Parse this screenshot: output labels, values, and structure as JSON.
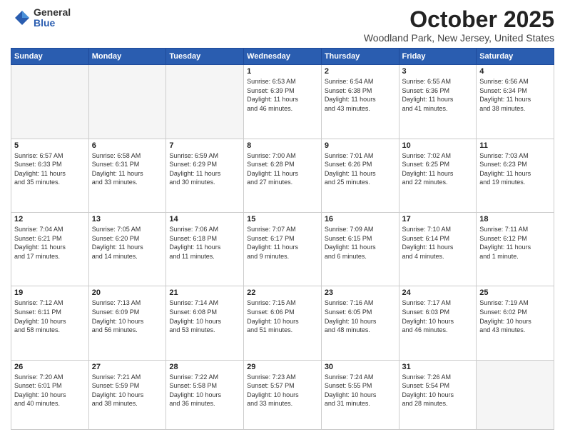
{
  "header": {
    "logo_general": "General",
    "logo_blue": "Blue",
    "month_title": "October 2025",
    "location": "Woodland Park, New Jersey, United States"
  },
  "days_of_week": [
    "Sunday",
    "Monday",
    "Tuesday",
    "Wednesday",
    "Thursday",
    "Friday",
    "Saturday"
  ],
  "weeks": [
    [
      {
        "day": "",
        "info": ""
      },
      {
        "day": "",
        "info": ""
      },
      {
        "day": "",
        "info": ""
      },
      {
        "day": "1",
        "info": "Sunrise: 6:53 AM\nSunset: 6:39 PM\nDaylight: 11 hours\nand 46 minutes."
      },
      {
        "day": "2",
        "info": "Sunrise: 6:54 AM\nSunset: 6:38 PM\nDaylight: 11 hours\nand 43 minutes."
      },
      {
        "day": "3",
        "info": "Sunrise: 6:55 AM\nSunset: 6:36 PM\nDaylight: 11 hours\nand 41 minutes."
      },
      {
        "day": "4",
        "info": "Sunrise: 6:56 AM\nSunset: 6:34 PM\nDaylight: 11 hours\nand 38 minutes."
      }
    ],
    [
      {
        "day": "5",
        "info": "Sunrise: 6:57 AM\nSunset: 6:33 PM\nDaylight: 11 hours\nand 35 minutes."
      },
      {
        "day": "6",
        "info": "Sunrise: 6:58 AM\nSunset: 6:31 PM\nDaylight: 11 hours\nand 33 minutes."
      },
      {
        "day": "7",
        "info": "Sunrise: 6:59 AM\nSunset: 6:29 PM\nDaylight: 11 hours\nand 30 minutes."
      },
      {
        "day": "8",
        "info": "Sunrise: 7:00 AM\nSunset: 6:28 PM\nDaylight: 11 hours\nand 27 minutes."
      },
      {
        "day": "9",
        "info": "Sunrise: 7:01 AM\nSunset: 6:26 PM\nDaylight: 11 hours\nand 25 minutes."
      },
      {
        "day": "10",
        "info": "Sunrise: 7:02 AM\nSunset: 6:25 PM\nDaylight: 11 hours\nand 22 minutes."
      },
      {
        "day": "11",
        "info": "Sunrise: 7:03 AM\nSunset: 6:23 PM\nDaylight: 11 hours\nand 19 minutes."
      }
    ],
    [
      {
        "day": "12",
        "info": "Sunrise: 7:04 AM\nSunset: 6:21 PM\nDaylight: 11 hours\nand 17 minutes."
      },
      {
        "day": "13",
        "info": "Sunrise: 7:05 AM\nSunset: 6:20 PM\nDaylight: 11 hours\nand 14 minutes."
      },
      {
        "day": "14",
        "info": "Sunrise: 7:06 AM\nSunset: 6:18 PM\nDaylight: 11 hours\nand 11 minutes."
      },
      {
        "day": "15",
        "info": "Sunrise: 7:07 AM\nSunset: 6:17 PM\nDaylight: 11 hours\nand 9 minutes."
      },
      {
        "day": "16",
        "info": "Sunrise: 7:09 AM\nSunset: 6:15 PM\nDaylight: 11 hours\nand 6 minutes."
      },
      {
        "day": "17",
        "info": "Sunrise: 7:10 AM\nSunset: 6:14 PM\nDaylight: 11 hours\nand 4 minutes."
      },
      {
        "day": "18",
        "info": "Sunrise: 7:11 AM\nSunset: 6:12 PM\nDaylight: 11 hours\nand 1 minute."
      }
    ],
    [
      {
        "day": "19",
        "info": "Sunrise: 7:12 AM\nSunset: 6:11 PM\nDaylight: 10 hours\nand 58 minutes."
      },
      {
        "day": "20",
        "info": "Sunrise: 7:13 AM\nSunset: 6:09 PM\nDaylight: 10 hours\nand 56 minutes."
      },
      {
        "day": "21",
        "info": "Sunrise: 7:14 AM\nSunset: 6:08 PM\nDaylight: 10 hours\nand 53 minutes."
      },
      {
        "day": "22",
        "info": "Sunrise: 7:15 AM\nSunset: 6:06 PM\nDaylight: 10 hours\nand 51 minutes."
      },
      {
        "day": "23",
        "info": "Sunrise: 7:16 AM\nSunset: 6:05 PM\nDaylight: 10 hours\nand 48 minutes."
      },
      {
        "day": "24",
        "info": "Sunrise: 7:17 AM\nSunset: 6:03 PM\nDaylight: 10 hours\nand 46 minutes."
      },
      {
        "day": "25",
        "info": "Sunrise: 7:19 AM\nSunset: 6:02 PM\nDaylight: 10 hours\nand 43 minutes."
      }
    ],
    [
      {
        "day": "26",
        "info": "Sunrise: 7:20 AM\nSunset: 6:01 PM\nDaylight: 10 hours\nand 40 minutes."
      },
      {
        "day": "27",
        "info": "Sunrise: 7:21 AM\nSunset: 5:59 PM\nDaylight: 10 hours\nand 38 minutes."
      },
      {
        "day": "28",
        "info": "Sunrise: 7:22 AM\nSunset: 5:58 PM\nDaylight: 10 hours\nand 36 minutes."
      },
      {
        "day": "29",
        "info": "Sunrise: 7:23 AM\nSunset: 5:57 PM\nDaylight: 10 hours\nand 33 minutes."
      },
      {
        "day": "30",
        "info": "Sunrise: 7:24 AM\nSunset: 5:55 PM\nDaylight: 10 hours\nand 31 minutes."
      },
      {
        "day": "31",
        "info": "Sunrise: 7:26 AM\nSunset: 5:54 PM\nDaylight: 10 hours\nand 28 minutes."
      },
      {
        "day": "",
        "info": ""
      }
    ]
  ]
}
